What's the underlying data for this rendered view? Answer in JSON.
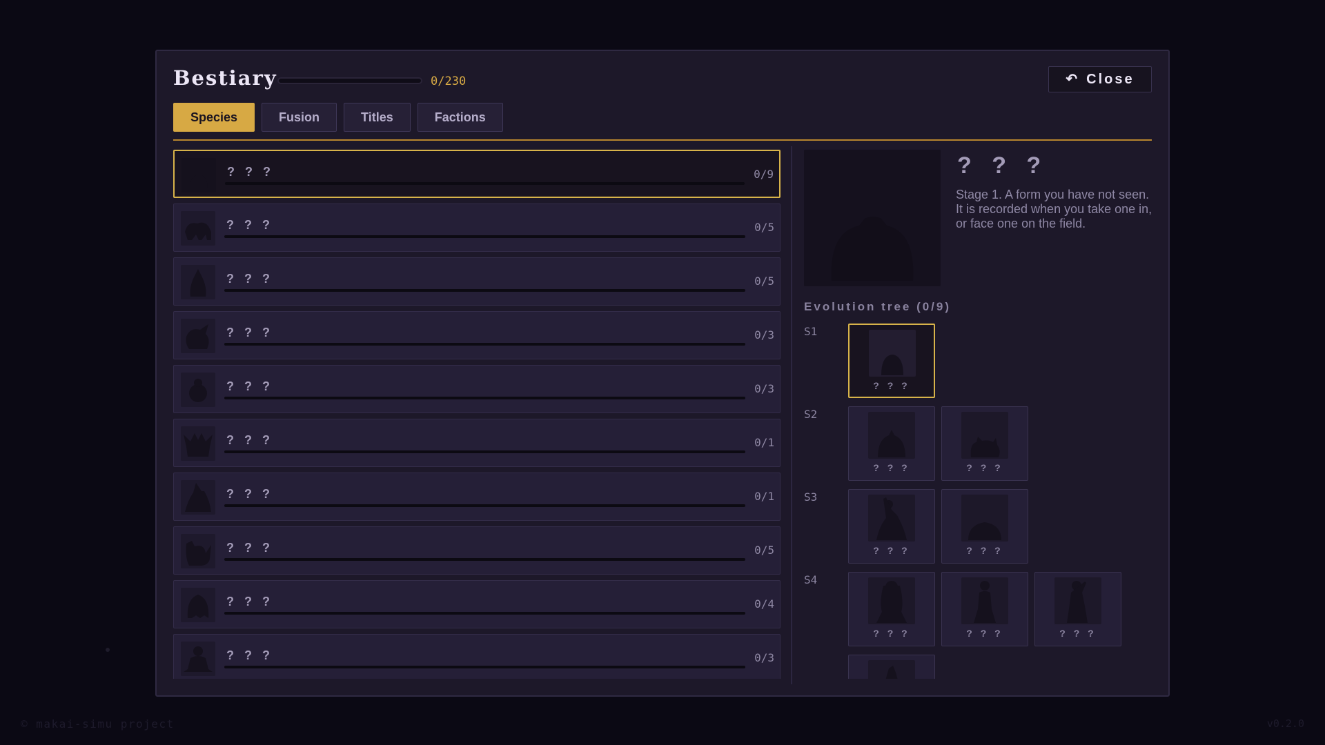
{
  "header": {
    "title": "Bestiary",
    "progress_text": "0/230",
    "progress_fraction": 0,
    "close_label": "Close",
    "close_icon": "undo-arrow-icon"
  },
  "tabs": [
    {
      "label": "Species",
      "active": true
    },
    {
      "label": "Fusion",
      "active": false
    },
    {
      "label": "Titles",
      "active": false
    },
    {
      "label": "Factions",
      "active": false
    }
  ],
  "species": [
    {
      "name": "? ? ?",
      "count": "0/9",
      "progress": 0,
      "selected": true
    },
    {
      "name": "? ? ?",
      "count": "0/5",
      "progress": 0
    },
    {
      "name": "? ? ?",
      "count": "0/5",
      "progress": 0
    },
    {
      "name": "? ? ?",
      "count": "0/3",
      "progress": 0
    },
    {
      "name": "? ? ?",
      "count": "0/3",
      "progress": 0
    },
    {
      "name": "? ? ?",
      "count": "0/1",
      "progress": 0
    },
    {
      "name": "? ? ?",
      "count": "0/1",
      "progress": 0
    },
    {
      "name": "? ? ?",
      "count": "0/5",
      "progress": 0
    },
    {
      "name": "? ? ?",
      "count": "0/4",
      "progress": 0
    },
    {
      "name": "? ? ?",
      "count": "0/3",
      "progress": 0
    }
  ],
  "detail": {
    "name": "? ? ?",
    "description": "Stage 1. A form you have not seen. It is recorded when you take one in, or face one on the field.",
    "evolution_title": "Evolution tree (0/9)",
    "stages": [
      {
        "label": "S1",
        "nodes": [
          {
            "name": "? ? ?",
            "selected": true
          }
        ]
      },
      {
        "label": "S2",
        "nodes": [
          {
            "name": "? ? ?"
          },
          {
            "name": "? ? ?"
          }
        ]
      },
      {
        "label": "S3",
        "nodes": [
          {
            "name": "? ? ?"
          },
          {
            "name": "? ? ?"
          }
        ]
      },
      {
        "label": "S4",
        "nodes": [
          {
            "name": "? ? ?"
          },
          {
            "name": "? ? ?"
          },
          {
            "name": "? ? ?"
          },
          {
            "name": ""
          }
        ]
      }
    ]
  },
  "footer": {
    "copyright": "© makai-simu project",
    "version": "v0.2.0"
  },
  "colors": {
    "accent": "#d7a944",
    "background": "#0b0914",
    "panel": "#1d1829"
  }
}
